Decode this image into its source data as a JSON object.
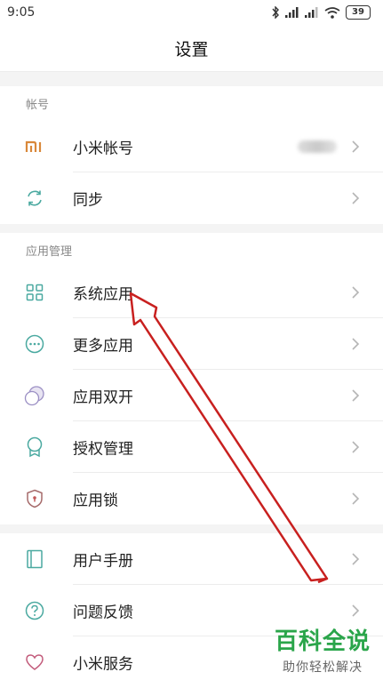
{
  "status_bar": {
    "time": "9:05",
    "battery": "39"
  },
  "title": "设置",
  "sections": [
    {
      "header": "帐号",
      "items": [
        {
          "label": "小米帐号",
          "icon": "mi-logo-icon"
        },
        {
          "label": "同步",
          "icon": "sync-icon"
        }
      ]
    },
    {
      "header": "应用管理",
      "items": [
        {
          "label": "系统应用",
          "icon": "grid-icon"
        },
        {
          "label": "更多应用",
          "icon": "more-icon"
        },
        {
          "label": "应用双开",
          "icon": "dual-app-icon"
        },
        {
          "label": "授权管理",
          "icon": "authorization-icon"
        },
        {
          "label": "应用锁",
          "icon": "app-lock-icon"
        }
      ]
    },
    {
      "header": "",
      "items": [
        {
          "label": "用户手册",
          "icon": "manual-icon"
        },
        {
          "label": "问题反馈",
          "icon": "feedback-icon"
        },
        {
          "label": "小米服务",
          "icon": "heart-icon"
        }
      ]
    }
  ],
  "watermark": {
    "title": "百科全说",
    "subtitle": "助你轻松解决"
  },
  "colors": {
    "accent_teal": "#4aa9a0",
    "mi_orange": "#d9883a",
    "arrow_red": "#c8201f",
    "watermark_green": "#2aa54a"
  }
}
